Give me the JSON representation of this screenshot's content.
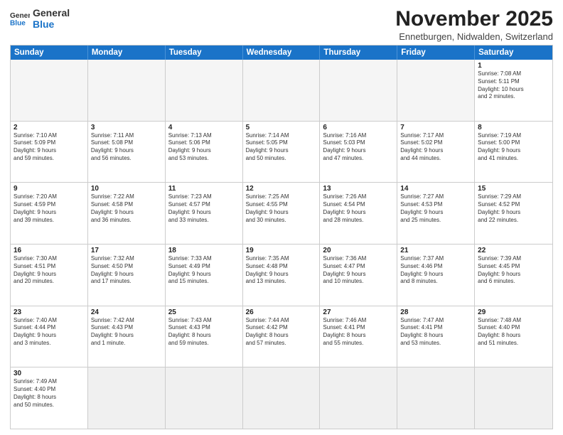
{
  "logo": {
    "line1": "General",
    "line2": "Blue"
  },
  "title": "November 2025",
  "location": "Ennetburgen, Nidwalden, Switzerland",
  "headers": [
    "Sunday",
    "Monday",
    "Tuesday",
    "Wednesday",
    "Thursday",
    "Friday",
    "Saturday"
  ],
  "weeks": [
    [
      {
        "day": "",
        "info": ""
      },
      {
        "day": "",
        "info": ""
      },
      {
        "day": "",
        "info": ""
      },
      {
        "day": "",
        "info": ""
      },
      {
        "day": "",
        "info": ""
      },
      {
        "day": "",
        "info": ""
      },
      {
        "day": "1",
        "info": "Sunrise: 7:08 AM\nSunset: 5:11 PM\nDaylight: 10 hours\nand 2 minutes."
      }
    ],
    [
      {
        "day": "2",
        "info": "Sunrise: 7:10 AM\nSunset: 5:09 PM\nDaylight: 9 hours\nand 59 minutes."
      },
      {
        "day": "3",
        "info": "Sunrise: 7:11 AM\nSunset: 5:08 PM\nDaylight: 9 hours\nand 56 minutes."
      },
      {
        "day": "4",
        "info": "Sunrise: 7:13 AM\nSunset: 5:06 PM\nDaylight: 9 hours\nand 53 minutes."
      },
      {
        "day": "5",
        "info": "Sunrise: 7:14 AM\nSunset: 5:05 PM\nDaylight: 9 hours\nand 50 minutes."
      },
      {
        "day": "6",
        "info": "Sunrise: 7:16 AM\nSunset: 5:03 PM\nDaylight: 9 hours\nand 47 minutes."
      },
      {
        "day": "7",
        "info": "Sunrise: 7:17 AM\nSunset: 5:02 PM\nDaylight: 9 hours\nand 44 minutes."
      },
      {
        "day": "8",
        "info": "Sunrise: 7:19 AM\nSunset: 5:00 PM\nDaylight: 9 hours\nand 41 minutes."
      }
    ],
    [
      {
        "day": "9",
        "info": "Sunrise: 7:20 AM\nSunset: 4:59 PM\nDaylight: 9 hours\nand 39 minutes."
      },
      {
        "day": "10",
        "info": "Sunrise: 7:22 AM\nSunset: 4:58 PM\nDaylight: 9 hours\nand 36 minutes."
      },
      {
        "day": "11",
        "info": "Sunrise: 7:23 AM\nSunset: 4:57 PM\nDaylight: 9 hours\nand 33 minutes."
      },
      {
        "day": "12",
        "info": "Sunrise: 7:25 AM\nSunset: 4:55 PM\nDaylight: 9 hours\nand 30 minutes."
      },
      {
        "day": "13",
        "info": "Sunrise: 7:26 AM\nSunset: 4:54 PM\nDaylight: 9 hours\nand 28 minutes."
      },
      {
        "day": "14",
        "info": "Sunrise: 7:27 AM\nSunset: 4:53 PM\nDaylight: 9 hours\nand 25 minutes."
      },
      {
        "day": "15",
        "info": "Sunrise: 7:29 AM\nSunset: 4:52 PM\nDaylight: 9 hours\nand 22 minutes."
      }
    ],
    [
      {
        "day": "16",
        "info": "Sunrise: 7:30 AM\nSunset: 4:51 PM\nDaylight: 9 hours\nand 20 minutes."
      },
      {
        "day": "17",
        "info": "Sunrise: 7:32 AM\nSunset: 4:50 PM\nDaylight: 9 hours\nand 17 minutes."
      },
      {
        "day": "18",
        "info": "Sunrise: 7:33 AM\nSunset: 4:49 PM\nDaylight: 9 hours\nand 15 minutes."
      },
      {
        "day": "19",
        "info": "Sunrise: 7:35 AM\nSunset: 4:48 PM\nDaylight: 9 hours\nand 13 minutes."
      },
      {
        "day": "20",
        "info": "Sunrise: 7:36 AM\nSunset: 4:47 PM\nDaylight: 9 hours\nand 10 minutes."
      },
      {
        "day": "21",
        "info": "Sunrise: 7:37 AM\nSunset: 4:46 PM\nDaylight: 9 hours\nand 8 minutes."
      },
      {
        "day": "22",
        "info": "Sunrise: 7:39 AM\nSunset: 4:45 PM\nDaylight: 9 hours\nand 6 minutes."
      }
    ],
    [
      {
        "day": "23",
        "info": "Sunrise: 7:40 AM\nSunset: 4:44 PM\nDaylight: 9 hours\nand 3 minutes."
      },
      {
        "day": "24",
        "info": "Sunrise: 7:42 AM\nSunset: 4:43 PM\nDaylight: 9 hours\nand 1 minute."
      },
      {
        "day": "25",
        "info": "Sunrise: 7:43 AM\nSunset: 4:43 PM\nDaylight: 8 hours\nand 59 minutes."
      },
      {
        "day": "26",
        "info": "Sunrise: 7:44 AM\nSunset: 4:42 PM\nDaylight: 8 hours\nand 57 minutes."
      },
      {
        "day": "27",
        "info": "Sunrise: 7:46 AM\nSunset: 4:41 PM\nDaylight: 8 hours\nand 55 minutes."
      },
      {
        "day": "28",
        "info": "Sunrise: 7:47 AM\nSunset: 4:41 PM\nDaylight: 8 hours\nand 53 minutes."
      },
      {
        "day": "29",
        "info": "Sunrise: 7:48 AM\nSunset: 4:40 PM\nDaylight: 8 hours\nand 51 minutes."
      }
    ],
    [
      {
        "day": "30",
        "info": "Sunrise: 7:49 AM\nSunset: 4:40 PM\nDaylight: 8 hours\nand 50 minutes."
      },
      {
        "day": "",
        "info": ""
      },
      {
        "day": "",
        "info": ""
      },
      {
        "day": "",
        "info": ""
      },
      {
        "day": "",
        "info": ""
      },
      {
        "day": "",
        "info": ""
      },
      {
        "day": "",
        "info": ""
      }
    ]
  ]
}
